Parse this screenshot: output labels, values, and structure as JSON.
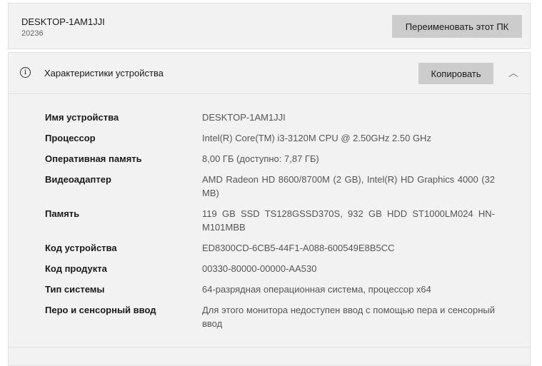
{
  "pc": {
    "name": "DESKTOP-1AM1JJI",
    "sub": "20236",
    "rename_label": "Переименовать этот ПК"
  },
  "specs": {
    "title": "Характеристики устройства",
    "copy_label": "Копировать",
    "rows": [
      {
        "label": "Имя устройства",
        "value": "DESKTOP-1AM1JJI"
      },
      {
        "label": "Процессор",
        "value": "Intel(R) Core(TM) i3-3120M CPU @ 2.50GHz   2.50 GHz"
      },
      {
        "label": "Оперативная память",
        "value": "8,00 ГБ (доступно: 7,87 ГБ)"
      },
      {
        "label": "Видеоадаптер",
        "value": "AMD Radeon HD 8600/8700M (2 GB), Intel(R) HD Graphics 4000 (32 MB)"
      },
      {
        "label": "Память",
        "value": "119 GB SSD TS128GSSD370S, 932 GB HDD ST1000LM024 HN-M101MBB"
      },
      {
        "label": "Код устройства",
        "value": "ED8300CD-6CB5-44F1-A088-600549E8B5CC"
      },
      {
        "label": "Код продукта",
        "value": "00330-80000-00000-AA530"
      },
      {
        "label": "Тип системы",
        "value": "64-разрядная операционная система, процессор x64"
      },
      {
        "label": "Перо и сенсорный ввод",
        "value": "Для этого монитора недоступен ввод с помощью пера и сенсорный ввод"
      }
    ]
  }
}
